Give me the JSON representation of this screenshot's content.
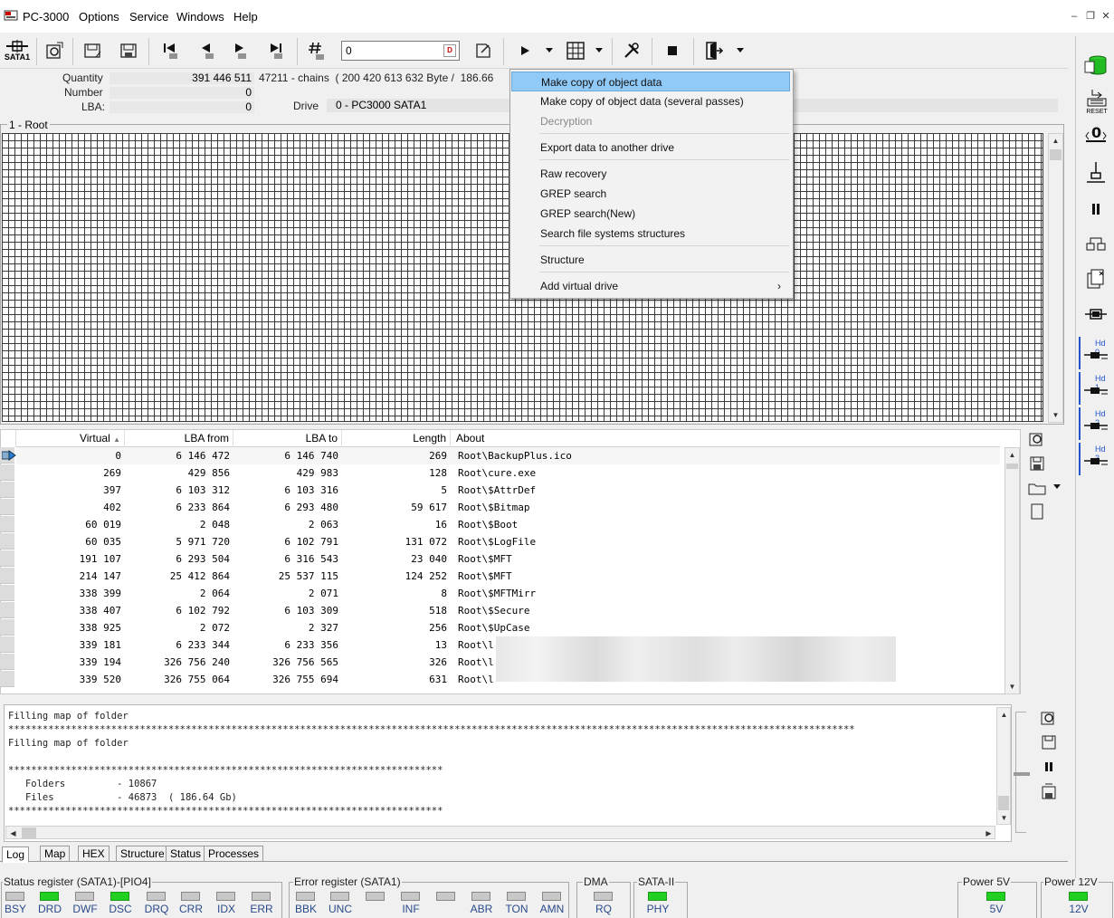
{
  "app": {
    "title": "PC-3000"
  },
  "menubar": [
    "Options",
    "Service",
    "Windows",
    "Help"
  ],
  "toolbar": {
    "sata_label": "SATA1",
    "address_value": "0"
  },
  "info": {
    "quantity_label": "Quantity",
    "quantity_value": "391 446 511",
    "quantity_extra": "47211 - chains  ( 200 420 613 632 Byte /  186.66",
    "number_label": "Number",
    "number_value": "0",
    "lba_label": "LBA:",
    "lba_value": "0",
    "drive_label": "Drive",
    "drive_value": "0 - PC3000 SATA1"
  },
  "map": {
    "legend": "1 - Root"
  },
  "table": {
    "columns": [
      "Virtual",
      "LBA from",
      "LBA to",
      "Length",
      "About"
    ],
    "sort_indicator": "▲",
    "rows": [
      [
        "0",
        "6 146 472",
        "6 146 740",
        "269",
        "Root\\BackupPlus.ico"
      ],
      [
        "269",
        "429 856",
        "429 983",
        "128",
        "Root\\cure.exe"
      ],
      [
        "397",
        "6 103 312",
        "6 103 316",
        "5",
        "Root\\$AttrDef"
      ],
      [
        "402",
        "6 233 864",
        "6 293 480",
        "59 617",
        "Root\\$Bitmap"
      ],
      [
        "60 019",
        "2 048",
        "2 063",
        "16",
        "Root\\$Boot"
      ],
      [
        "60 035",
        "5 971 720",
        "6 102 791",
        "131 072",
        "Root\\$LogFile"
      ],
      [
        "191 107",
        "6 293 504",
        "6 316 543",
        "23 040",
        "Root\\$MFT"
      ],
      [
        "214 147",
        "25 412 864",
        "25 537 115",
        "124 252",
        "Root\\$MFT"
      ],
      [
        "338 399",
        "2 064",
        "2 071",
        "8",
        "Root\\$MFTMirr"
      ],
      [
        "338 407",
        "6 102 792",
        "6 103 309",
        "518",
        "Root\\$Secure"
      ],
      [
        "338 925",
        "2 072",
        "2 327",
        "256",
        "Root\\$UpCase"
      ],
      [
        "339 181",
        "6 233 344",
        "6 233 356",
        "13",
        "Root\\l"
      ],
      [
        "339 194",
        "326 756 240",
        "326 756 565",
        "326",
        "Root\\l"
      ],
      [
        "339 520",
        "326 755 064",
        "326 755 694",
        "631",
        "Root\\l"
      ]
    ]
  },
  "log": {
    "lines": [
      "Filling map of folder",
      "****************************************************************************************************************************************************",
      "Filling map of folder",
      "",
      "****************************************************************************",
      "   Folders         - 10867",
      "   Files           - 46873  ( 186.64 Gb)",
      "****************************************************************************"
    ]
  },
  "tabs": [
    "Log",
    "Map",
    "HEX",
    "Structure",
    "Status",
    "Processes"
  ],
  "status": {
    "status_register_title": "Status register (SATA1)-[PIO4]",
    "status_leds": [
      {
        "label": "BSY",
        "on": false
      },
      {
        "label": "DRD",
        "on": true
      },
      {
        "label": "DWF",
        "on": false
      },
      {
        "label": "DSC",
        "on": true
      },
      {
        "label": "DRQ",
        "on": false
      },
      {
        "label": "CRR",
        "on": false
      },
      {
        "label": "IDX",
        "on": false
      },
      {
        "label": "ERR",
        "on": false
      }
    ],
    "error_register_title": "Error register (SATA1)",
    "error_leds": [
      {
        "label": "BBK",
        "on": false
      },
      {
        "label": "UNC",
        "on": false
      },
      {
        "label": "",
        "on": false
      },
      {
        "label": "INF",
        "on": false
      },
      {
        "label": "",
        "on": false
      },
      {
        "label": "ABR",
        "on": false
      },
      {
        "label": "TON",
        "on": false
      },
      {
        "label": "AMN",
        "on": false
      }
    ],
    "dma_title": "DMA",
    "dma_led": {
      "label": "RQ",
      "on": false
    },
    "sata_title": "SATA-II",
    "sata_led": {
      "label": "PHY",
      "on": true
    },
    "power5_title": "Power 5V",
    "power5_led": {
      "label": "5V",
      "on": true
    },
    "power12_title": "Power 12V",
    "power12_led": {
      "label": "12V",
      "on": true
    }
  },
  "right_panel": {
    "reset_label": "RESET",
    "hd_labels": [
      "Hd 0",
      "Hd 1",
      "Hd 2",
      "Hd 3"
    ]
  },
  "context_menu": {
    "items": [
      {
        "label": "Make copy of object data",
        "highlighted": true
      },
      {
        "label": "Make copy of object data (several passes)"
      },
      {
        "label": "Decryption",
        "disabled": true
      },
      {
        "label": "Export data to another drive"
      },
      {
        "label": "Raw recovery"
      },
      {
        "label": "GREP search"
      },
      {
        "label": "GREP search(New)"
      },
      {
        "label": "Search file systems structures"
      },
      {
        "label": "Structure"
      },
      {
        "label": "Add virtual drive",
        "submenu": true
      }
    ]
  }
}
